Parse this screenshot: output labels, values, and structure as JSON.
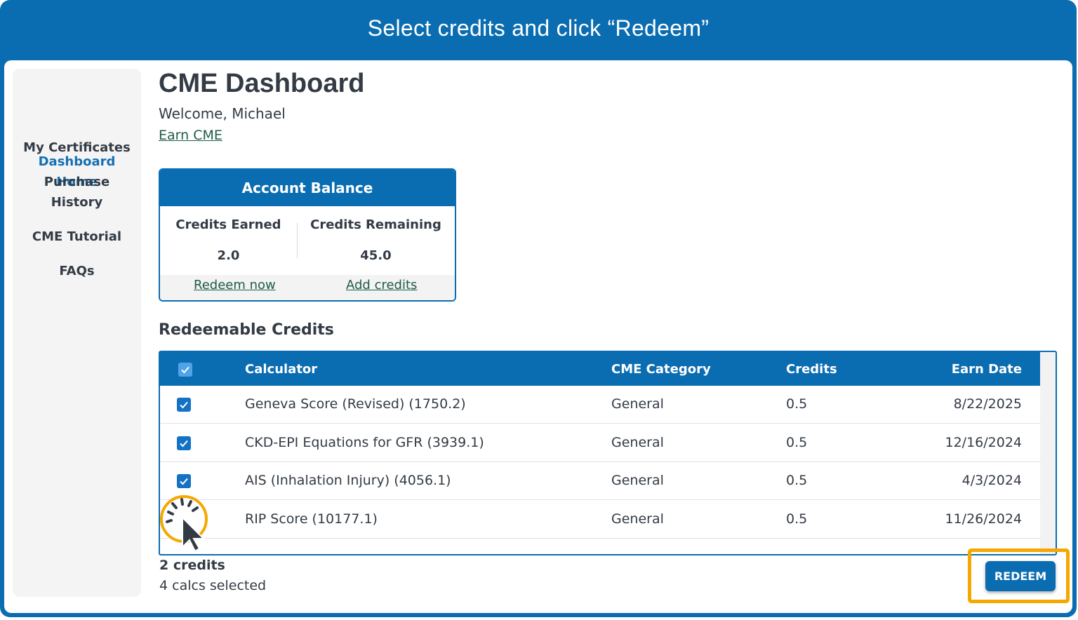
{
  "banner": {
    "text": "Select credits and click “Redeem”"
  },
  "sidebar": {
    "items": [
      {
        "line1": "Dashboard",
        "line2": "Home",
        "active": true
      },
      {
        "line1": "My Certificates",
        "line2": ""
      },
      {
        "line1": "Purchase",
        "line2": "History"
      },
      {
        "line1": "CME Tutorial",
        "line2": ""
      },
      {
        "line1": "FAQs",
        "line2": ""
      }
    ]
  },
  "header": {
    "title": "CME Dashboard",
    "welcome": "Welcome, Michael",
    "earn_link": "Earn CME"
  },
  "balance": {
    "title": "Account Balance",
    "earned_label": "Credits Earned",
    "earned_value": "2.0",
    "remaining_label": "Credits Remaining",
    "remaining_value": "45.0",
    "redeem_link": "Redeem now",
    "add_link": "Add credits"
  },
  "redeemable": {
    "title": "Redeemable Credits",
    "columns": [
      "Calculator",
      "CME Category",
      "Credits",
      "Earn Date"
    ],
    "rows": [
      {
        "calculator": "Geneva Score (Revised) (1750.2)",
        "category": "General",
        "credits": "0.5",
        "date": "8/22/2025",
        "checked": true
      },
      {
        "calculator": "CKD-EPI Equations for GFR (3939.1)",
        "category": "General",
        "credits": "0.5",
        "date": "12/16/2024",
        "checked": true
      },
      {
        "calculator": "AIS (Inhalation Injury) (4056.1)",
        "category": "General",
        "credits": "0.5",
        "date": "4/3/2024",
        "checked": true
      },
      {
        "calculator": "RIP Score (10177.1)",
        "category": "General",
        "credits": "0.5",
        "date": "11/26/2024",
        "checked": true
      }
    ],
    "summary_credits": "2 credits",
    "summary_calcs": "4 calcs selected",
    "redeem_button": "REDEEM"
  },
  "colors": {
    "primary": "#0b6db1",
    "highlight": "#f5a800",
    "link": "#1e5c4a",
    "checkbox": "#1472c4"
  }
}
